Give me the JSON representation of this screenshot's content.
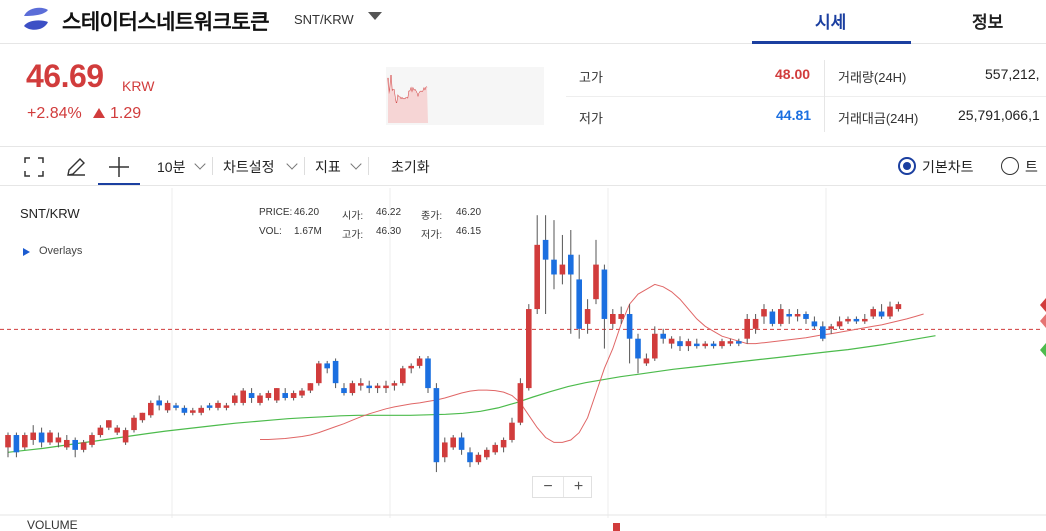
{
  "header": {
    "coin_name": "스테이터스네트워크토큰",
    "pair": "SNT/KRW",
    "tabs": [
      "시세",
      "정보"
    ]
  },
  "price": {
    "value": "46.69",
    "unit": "KRW",
    "change_pct": "+2.84%",
    "change_value": "1.29"
  },
  "stats": {
    "high_label": "고가",
    "high": "48.00",
    "low_label": "저가",
    "low": "44.81",
    "volume_label": "거래량(24H)",
    "volume": "557,212,",
    "amount_label": "거래대금(24H)",
    "amount": "25,791,066,1"
  },
  "toolbar": {
    "interval": "10분",
    "chart_settings": "차트설정",
    "indicators": "지표",
    "reset": "초기화",
    "basic_chart": "기본차트",
    "trading_chart": "트"
  },
  "chart": {
    "pair": "SNT/KRW",
    "overlays": "Overlays",
    "price_label": "PRICE:",
    "price": "46.20",
    "open_label": "시가:",
    "open": "46.22",
    "close_label": "종가:",
    "close": "46.20",
    "vol_label": "VOL:",
    "vol": "1.67M",
    "high_label": "고가:",
    "high": "46.30",
    "low_label": "저가:",
    "low": "46.15",
    "zoom_out": "−",
    "zoom_in": "+",
    "volume_title": "VOLUME"
  },
  "colors": {
    "up": "#d13c3c",
    "down": "#1b6fe0",
    "accent": "#1b3fa0",
    "ma_short": "#e06666",
    "ma_long": "#4cbb4c"
  },
  "chart_data": {
    "type": "candlestick",
    "pair": "SNT/KRW",
    "current_price": 46.69,
    "candles": [
      [
        44.3,
        44.55,
        44.1,
        44.6
      ],
      [
        44.55,
        44.2,
        44.1,
        44.6
      ],
      [
        44.3,
        44.55,
        44.25,
        44.6
      ],
      [
        44.45,
        44.6,
        44.35,
        44.75
      ],
      [
        44.6,
        44.4,
        44.3,
        44.7
      ],
      [
        44.4,
        44.6,
        44.35,
        44.65
      ],
      [
        44.4,
        44.5,
        44.3,
        44.6
      ],
      [
        44.3,
        44.45,
        44.25,
        44.55
      ],
      [
        44.45,
        44.25,
        44.1,
        44.5
      ],
      [
        44.25,
        44.4,
        44.2,
        44.45
      ],
      [
        44.35,
        44.55,
        44.3,
        44.6
      ],
      [
        44.55,
        44.7,
        44.5,
        44.75
      ],
      [
        44.7,
        44.85,
        44.65,
        44.85
      ],
      [
        44.6,
        44.7,
        44.55,
        44.75
      ],
      [
        44.4,
        44.65,
        44.35,
        44.7
      ],
      [
        44.65,
        44.9,
        44.6,
        44.95
      ],
      [
        44.85,
        45.0,
        44.8,
        45.0
      ],
      [
        44.95,
        45.2,
        44.9,
        45.25
      ],
      [
        45.25,
        45.15,
        45.05,
        45.35
      ],
      [
        45.05,
        45.2,
        45.0,
        45.25
      ],
      [
        45.15,
        45.1,
        45.05,
        45.2
      ],
      [
        45.1,
        45.0,
        44.95,
        45.15
      ],
      [
        45.0,
        45.05,
        44.95,
        45.1
      ],
      [
        45.0,
        45.1,
        44.95,
        45.15
      ],
      [
        45.15,
        45.1,
        45.05,
        45.2
      ],
      [
        45.1,
        45.2,
        45.05,
        45.25
      ],
      [
        45.1,
        45.15,
        45.05,
        45.2
      ],
      [
        45.2,
        45.35,
        45.15,
        45.4
      ],
      [
        45.2,
        45.45,
        45.15,
        45.5
      ],
      [
        45.4,
        45.3,
        45.2,
        45.5
      ],
      [
        45.2,
        45.35,
        45.15,
        45.4
      ],
      [
        45.3,
        45.4,
        45.25,
        45.45
      ],
      [
        45.25,
        45.5,
        45.2,
        45.5
      ],
      [
        45.4,
        45.3,
        45.25,
        45.5
      ],
      [
        45.3,
        45.4,
        45.25,
        45.45
      ],
      [
        45.35,
        45.45,
        45.3,
        45.5
      ],
      [
        45.45,
        45.6,
        45.4,
        45.6
      ],
      [
        45.6,
        46.0,
        45.55,
        46.05
      ],
      [
        46.0,
        45.9,
        45.8,
        46.05
      ],
      [
        46.05,
        45.6,
        45.5,
        46.1
      ],
      [
        45.5,
        45.4,
        45.35,
        45.6
      ],
      [
        45.4,
        45.6,
        45.35,
        45.65
      ],
      [
        45.55,
        45.6,
        45.45,
        45.7
      ],
      [
        45.55,
        45.5,
        45.4,
        45.65
      ],
      [
        45.5,
        45.55,
        45.4,
        45.6
      ],
      [
        45.5,
        45.55,
        45.4,
        45.65
      ],
      [
        45.55,
        45.6,
        45.45,
        45.65
      ],
      [
        45.6,
        45.9,
        45.55,
        45.95
      ],
      [
        45.9,
        45.95,
        45.8,
        46.0
      ],
      [
        45.95,
        46.1,
        45.9,
        46.15
      ],
      [
        46.1,
        45.5,
        45.4,
        46.15
      ],
      [
        45.5,
        44.0,
        43.8,
        45.6
      ],
      [
        44.1,
        44.4,
        44.0,
        44.5
      ],
      [
        44.3,
        44.5,
        44.25,
        44.55
      ],
      [
        44.5,
        44.25,
        44.15,
        44.6
      ],
      [
        44.2,
        44.0,
        43.9,
        44.3
      ],
      [
        44.0,
        44.15,
        43.95,
        44.2
      ],
      [
        44.1,
        44.25,
        44.05,
        44.3
      ],
      [
        44.2,
        44.35,
        44.15,
        44.4
      ],
      [
        44.3,
        44.45,
        44.2,
        44.5
      ],
      [
        44.45,
        44.8,
        44.4,
        44.9
      ],
      [
        44.8,
        45.6,
        44.75,
        45.7
      ],
      [
        45.5,
        47.1,
        45.45,
        47.2
      ],
      [
        47.1,
        48.4,
        47.0,
        49.0
      ],
      [
        48.5,
        48.1,
        47.0,
        49.0
      ],
      [
        48.1,
        47.8,
        47.5,
        48.9
      ],
      [
        47.8,
        48.0,
        47.6,
        48.6
      ],
      [
        48.2,
        47.8,
        46.6,
        48.7
      ],
      [
        47.7,
        46.7,
        46.5,
        48.2
      ],
      [
        46.8,
        47.1,
        46.6,
        47.3
      ],
      [
        47.3,
        48.0,
        47.2,
        48.5
      ],
      [
        47.9,
        46.9,
        46.3,
        48.0
      ],
      [
        46.8,
        47.0,
        46.7,
        47.1
      ],
      [
        46.9,
        47.0,
        46.8,
        47.15
      ],
      [
        47.0,
        46.5,
        46.0,
        47.2
      ],
      [
        46.5,
        46.1,
        45.8,
        46.6
      ],
      [
        46.0,
        46.1,
        45.95,
        46.2
      ],
      [
        46.1,
        46.6,
        46.05,
        46.75
      ],
      [
        46.6,
        46.5,
        46.4,
        46.7
      ],
      [
        46.4,
        46.5,
        46.3,
        46.55
      ],
      [
        46.45,
        46.35,
        46.25,
        46.55
      ],
      [
        46.35,
        46.45,
        46.25,
        46.5
      ],
      [
        46.4,
        46.35,
        46.3,
        46.5
      ],
      [
        46.35,
        46.4,
        46.3,
        46.45
      ],
      [
        46.4,
        46.35,
        46.3,
        46.45
      ],
      [
        46.35,
        46.45,
        46.3,
        46.5
      ],
      [
        46.4,
        46.45,
        46.35,
        46.5
      ],
      [
        46.45,
        46.4,
        46.35,
        46.5
      ],
      [
        46.5,
        46.9,
        46.4,
        47.0
      ],
      [
        46.7,
        46.9,
        46.6,
        47.0
      ],
      [
        46.95,
        47.1,
        46.8,
        47.2
      ],
      [
        47.05,
        46.8,
        46.75,
        47.1
      ],
      [
        46.8,
        47.1,
        46.75,
        47.2
      ],
      [
        47.0,
        46.95,
        46.8,
        47.1
      ],
      [
        46.95,
        47.0,
        46.85,
        47.1
      ],
      [
        47.0,
        46.9,
        46.8,
        47.05
      ],
      [
        46.85,
        46.75,
        46.7,
        46.95
      ],
      [
        46.75,
        46.5,
        46.45,
        46.85
      ],
      [
        46.7,
        46.75,
        46.6,
        46.8
      ],
      [
        46.75,
        46.85,
        46.7,
        46.95
      ],
      [
        46.85,
        46.9,
        46.8,
        46.95
      ],
      [
        46.9,
        46.85,
        46.8,
        46.95
      ],
      [
        46.85,
        46.9,
        46.8,
        47.0
      ],
      [
        46.95,
        47.1,
        46.9,
        47.15
      ],
      [
        47.05,
        46.95,
        46.9,
        47.2
      ],
      [
        46.95,
        47.15,
        46.9,
        47.25
      ],
      [
        47.1,
        47.2,
        47.05,
        47.25
      ]
    ],
    "ma_short": [
      44.46,
      44.46,
      44.47,
      44.48,
      44.5,
      44.52,
      44.55,
      44.6,
      44.66,
      44.72,
      44.78,
      44.85,
      44.92,
      44.98,
      45.03,
      45.08,
      45.12,
      45.15,
      45.18,
      45.2,
      45.23,
      45.26,
      45.3,
      45.35,
      45.4,
      45.44,
      45.46,
      45.46,
      45.45,
      45.42,
      45.35,
      45.2,
      44.95,
      44.7,
      44.5,
      44.4,
      44.4,
      44.45,
      44.6,
      44.9,
      45.4,
      45.9,
      46.3,
      46.8,
      47.2,
      47.4,
      47.5,
      47.6,
      47.55,
      47.45,
      47.3,
      47.1,
      46.9,
      46.75,
      46.65,
      46.55,
      46.5,
      46.45,
      46.4,
      46.4,
      46.42,
      46.44,
      46.46,
      46.48,
      46.5,
      46.52,
      46.55,
      46.58,
      46.6,
      46.63,
      46.66,
      46.69,
      46.72,
      46.75,
      46.78,
      46.82,
      46.86,
      46.9,
      46.95,
      47.0
    ],
    "ma_long": [
      44.2,
      44.24,
      44.28,
      44.33,
      44.38,
      44.43,
      44.48,
      44.53,
      44.58,
      44.63,
      44.67,
      44.71,
      44.75,
      44.79,
      44.82,
      44.85,
      44.88,
      44.9,
      44.92,
      44.94,
      44.95,
      44.95,
      44.95,
      44.95,
      44.96,
      44.97,
      44.99,
      45.03,
      45.1,
      45.2,
      45.32,
      45.43,
      45.53,
      45.61,
      45.67,
      45.73,
      45.78,
      45.83,
      45.88,
      45.92,
      45.96,
      46.0,
      46.04,
      46.08,
      46.12,
      46.16,
      46.2,
      46.24,
      46.28,
      46.33,
      46.38,
      46.44,
      46.5,
      46.56
    ]
  }
}
